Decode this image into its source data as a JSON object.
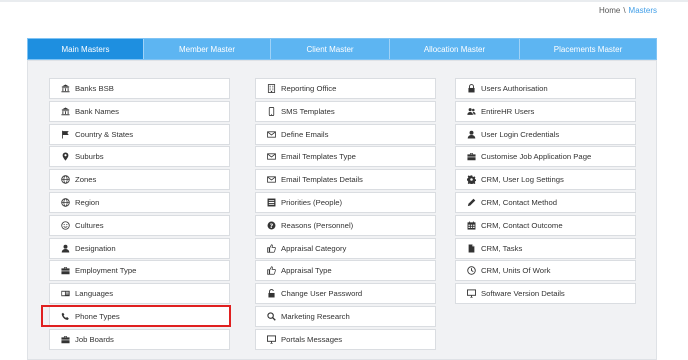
{
  "breadcrumb": {
    "home": "Home",
    "separator": "\\",
    "current": "Masters"
  },
  "tabs": [
    {
      "label": "Main Masters"
    },
    {
      "label": "Member Master"
    },
    {
      "label": "Client Master"
    },
    {
      "label": "Allocation Master"
    },
    {
      "label": "Placements Master"
    }
  ],
  "columns": [
    {
      "items": [
        {
          "label": "Banks BSB",
          "icon": "bank-icon"
        },
        {
          "label": "Bank Names",
          "icon": "bank-icon"
        },
        {
          "label": "Country & States",
          "icon": "flag-icon"
        },
        {
          "label": "Suburbs",
          "icon": "map-marker-icon"
        },
        {
          "label": "Zones",
          "icon": "globe-icon"
        },
        {
          "label": "Region",
          "icon": "globe-icon"
        },
        {
          "label": "Cultures",
          "icon": "smile-icon"
        },
        {
          "label": "Designation",
          "icon": "user-icon"
        },
        {
          "label": "Employment Type",
          "icon": "briefcase-icon"
        },
        {
          "label": "Languages",
          "icon": "id-card-icon"
        },
        {
          "label": "Phone Types",
          "icon": "phone-icon"
        },
        {
          "label": "Job Boards",
          "icon": "briefcase-icon"
        }
      ]
    },
    {
      "items": [
        {
          "label": "Reporting Office",
          "icon": "building-icon"
        },
        {
          "label": "SMS Templates",
          "icon": "mobile-icon"
        },
        {
          "label": "Define Emails",
          "icon": "envelope-icon"
        },
        {
          "label": "Email Templates Type",
          "icon": "envelope-icon"
        },
        {
          "label": "Email Templates Details",
          "icon": "envelope-icon"
        },
        {
          "label": "Priorities (People)",
          "icon": "list-icon"
        },
        {
          "label": "Reasons (Personnel)",
          "icon": "question-circle-icon"
        },
        {
          "label": "Appraisal Category",
          "icon": "thumbs-up-icon"
        },
        {
          "label": "Appraisal Type",
          "icon": "thumbs-up-icon"
        },
        {
          "label": "Change User Password",
          "icon": "unlock-icon"
        },
        {
          "label": "Marketing Research",
          "icon": "search-icon"
        },
        {
          "label": "Portals Messages",
          "icon": "monitor-icon"
        }
      ]
    },
    {
      "items": [
        {
          "label": "Users Authorisation",
          "icon": "user-lock-icon"
        },
        {
          "label": "EntireHR Users",
          "icon": "users-icon"
        },
        {
          "label": "User Login Credentials",
          "icon": "user-icon"
        },
        {
          "label": "Customise Job Application Page",
          "icon": "briefcase-icon"
        },
        {
          "label": "CRM, User Log Settings",
          "icon": "gear-icon"
        },
        {
          "label": "CRM, Contact Method",
          "icon": "pencil-icon"
        },
        {
          "label": "CRM, Contact Outcome",
          "icon": "calendar-icon"
        },
        {
          "label": "CRM, Tasks",
          "icon": "file-icon"
        },
        {
          "label": "CRM, Units Of Work",
          "icon": "clock-icon"
        },
        {
          "label": "Software Version Details",
          "icon": "monitor-icon"
        }
      ]
    }
  ],
  "colors": {
    "tab_bar": "#5db5f2",
    "tab_active": "#1e8fe0",
    "highlight": "#e02020",
    "link": "#3f9ee8"
  }
}
